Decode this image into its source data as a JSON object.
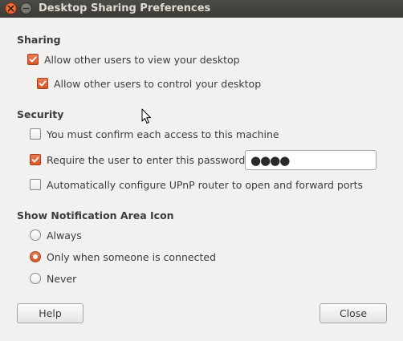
{
  "window": {
    "title": "Desktop Sharing Preferences"
  },
  "sharing": {
    "heading": "Sharing",
    "allow_view": {
      "label": "Allow other users to view your desktop",
      "checked": true
    },
    "allow_control": {
      "label": "Allow other users to control your desktop",
      "checked": true
    }
  },
  "security": {
    "heading": "Security",
    "confirm_access": {
      "label": "You must confirm each access to this machine",
      "checked": false
    },
    "require_password": {
      "label": "Require the user to enter this password:",
      "checked": true
    },
    "password_value": "●●●●",
    "upnp": {
      "label": "Automatically configure UPnP router to open and forward ports",
      "checked": false
    }
  },
  "notification": {
    "heading": "Show Notification Area Icon",
    "options": [
      {
        "label": "Always",
        "selected": false
      },
      {
        "label": "Only when someone is connected",
        "selected": true
      },
      {
        "label": "Never",
        "selected": false
      }
    ]
  },
  "buttons": {
    "help": "Help",
    "close": "Close"
  },
  "colors": {
    "accent": "#dd5a2b",
    "titlebar": "#3c3b37",
    "background": "#f2f1f0"
  },
  "icons": {
    "close": "close-icon",
    "minimize": "minimize-icon",
    "check": "check-icon",
    "cursor": "mouse-pointer-icon"
  }
}
